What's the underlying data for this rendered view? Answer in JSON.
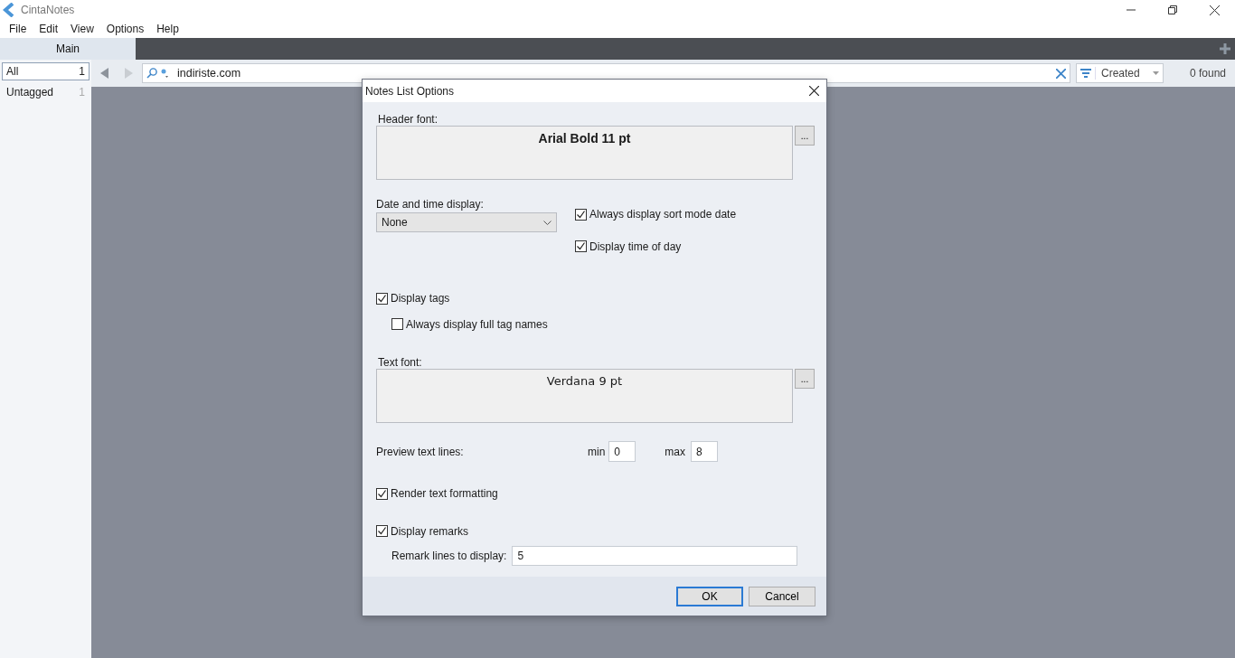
{
  "window": {
    "title": "CintaNotes"
  },
  "menu": [
    "File",
    "Edit",
    "View",
    "Options",
    "Help"
  ],
  "tabs": [
    {
      "label": "Main",
      "selected": true
    }
  ],
  "sidebar": {
    "items": [
      {
        "label": "All",
        "count": "1",
        "selected": true
      },
      {
        "label": "Untagged",
        "count": "1",
        "selected": false
      }
    ]
  },
  "search": {
    "value": "indiriste.com"
  },
  "sort": {
    "value": "Created"
  },
  "found": "0 found",
  "dialog": {
    "title": "Notes List Options",
    "header_font": {
      "label": "Header font:",
      "value": "Arial Bold 11 pt",
      "button": "..."
    },
    "date_display": {
      "label": "Date and time display:",
      "value": "None"
    },
    "always_sort_date": {
      "label": "Always display sort mode date",
      "checked": true
    },
    "time_of_day": {
      "label": "Display time of day",
      "checked": true
    },
    "display_tags": {
      "label": "Display tags",
      "checked": true
    },
    "full_tag_names": {
      "label": "Always display full tag names",
      "checked": false
    },
    "text_font": {
      "label": "Text font:",
      "value": "Verdana 9 pt",
      "button": "..."
    },
    "preview": {
      "label": "Preview text lines:",
      "min_label": "min",
      "min_value": "0",
      "max_label": "max",
      "max_value": "8"
    },
    "render_formatting": {
      "label": "Render text formatting",
      "checked": true
    },
    "display_remarks": {
      "label": "Display remarks",
      "checked": true
    },
    "remark_lines": {
      "label": "Remark lines to display:",
      "value": "5"
    },
    "buttons": [
      {
        "label": "OK",
        "default": true
      },
      {
        "label": "Cancel",
        "default": false
      }
    ]
  }
}
